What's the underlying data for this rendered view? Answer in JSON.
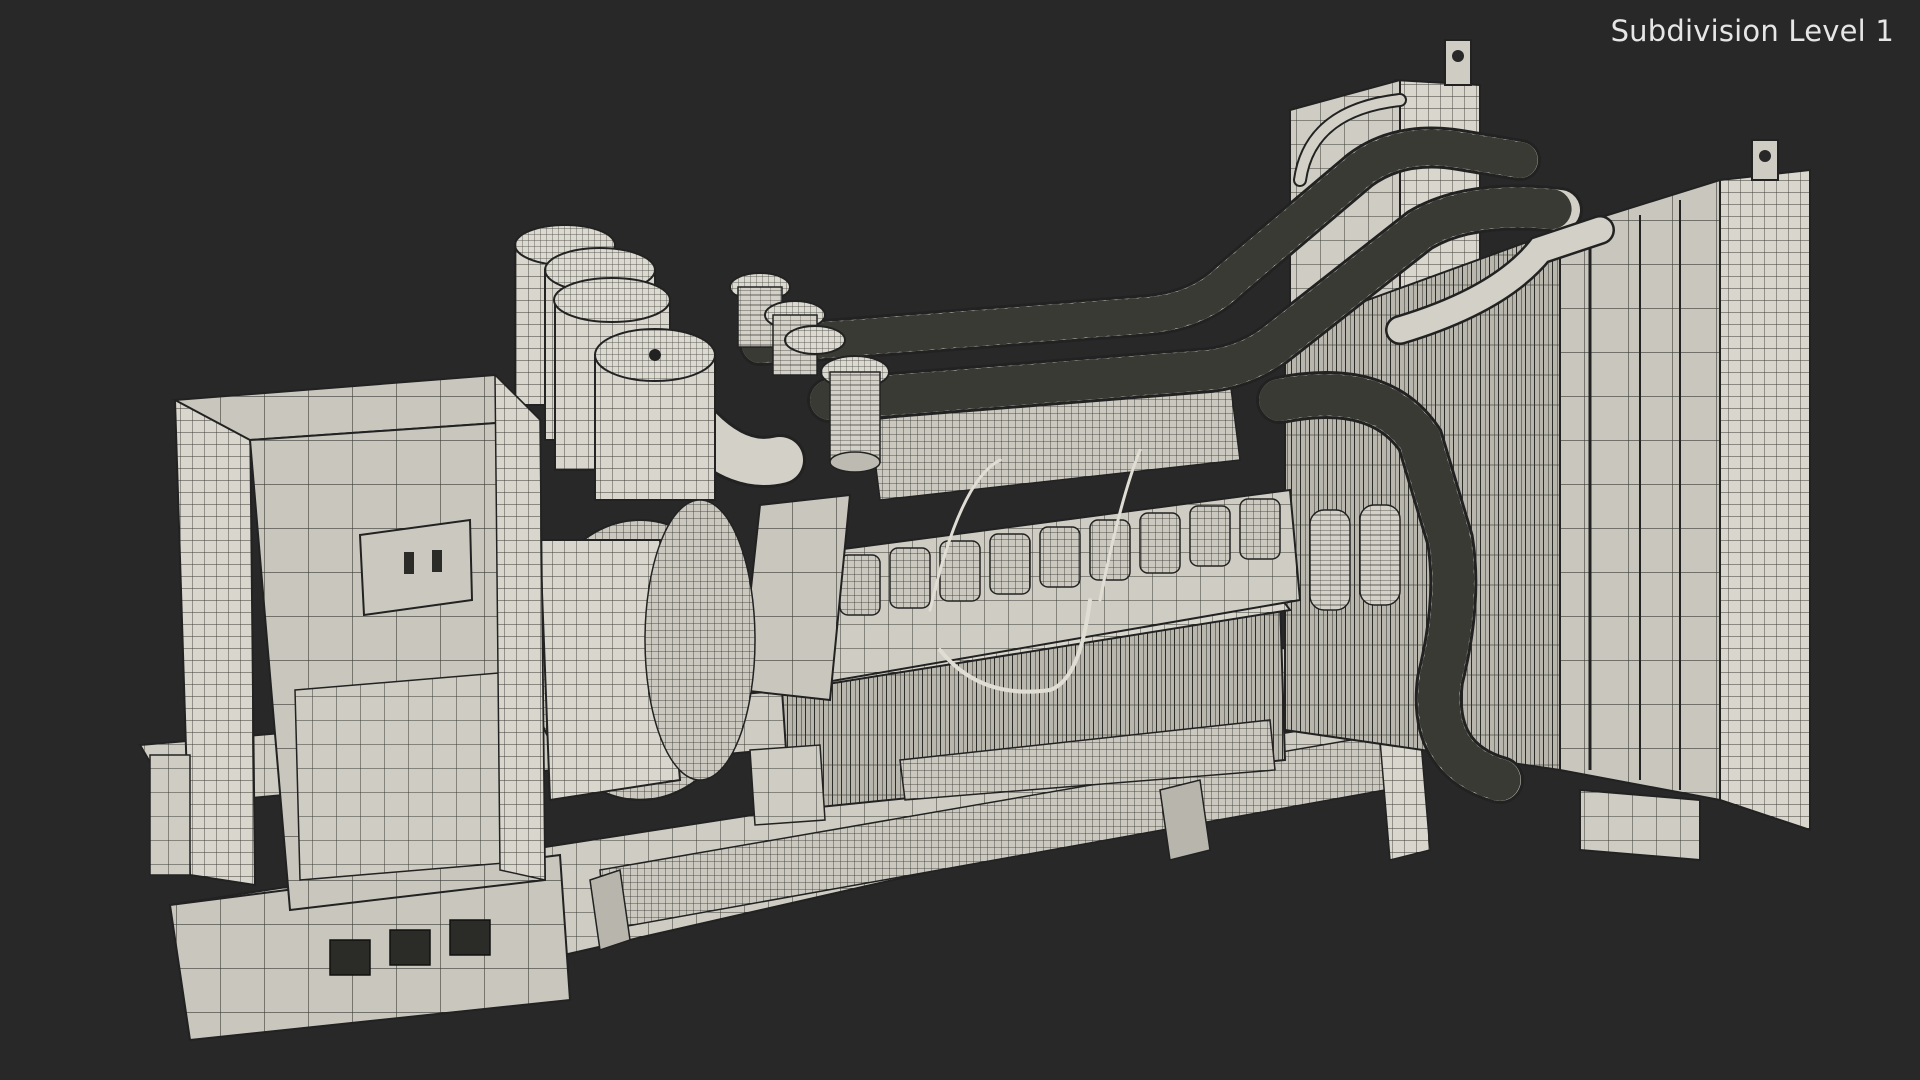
{
  "viewport": {
    "label": "Subdivision Level 1",
    "background": "#282828",
    "label_color": "#e6e6e6",
    "wire_color": "#1f1f1c",
    "surface_color": "#d9d7cd"
  },
  "model": {
    "subject": "industrial-generator-wireframe"
  }
}
